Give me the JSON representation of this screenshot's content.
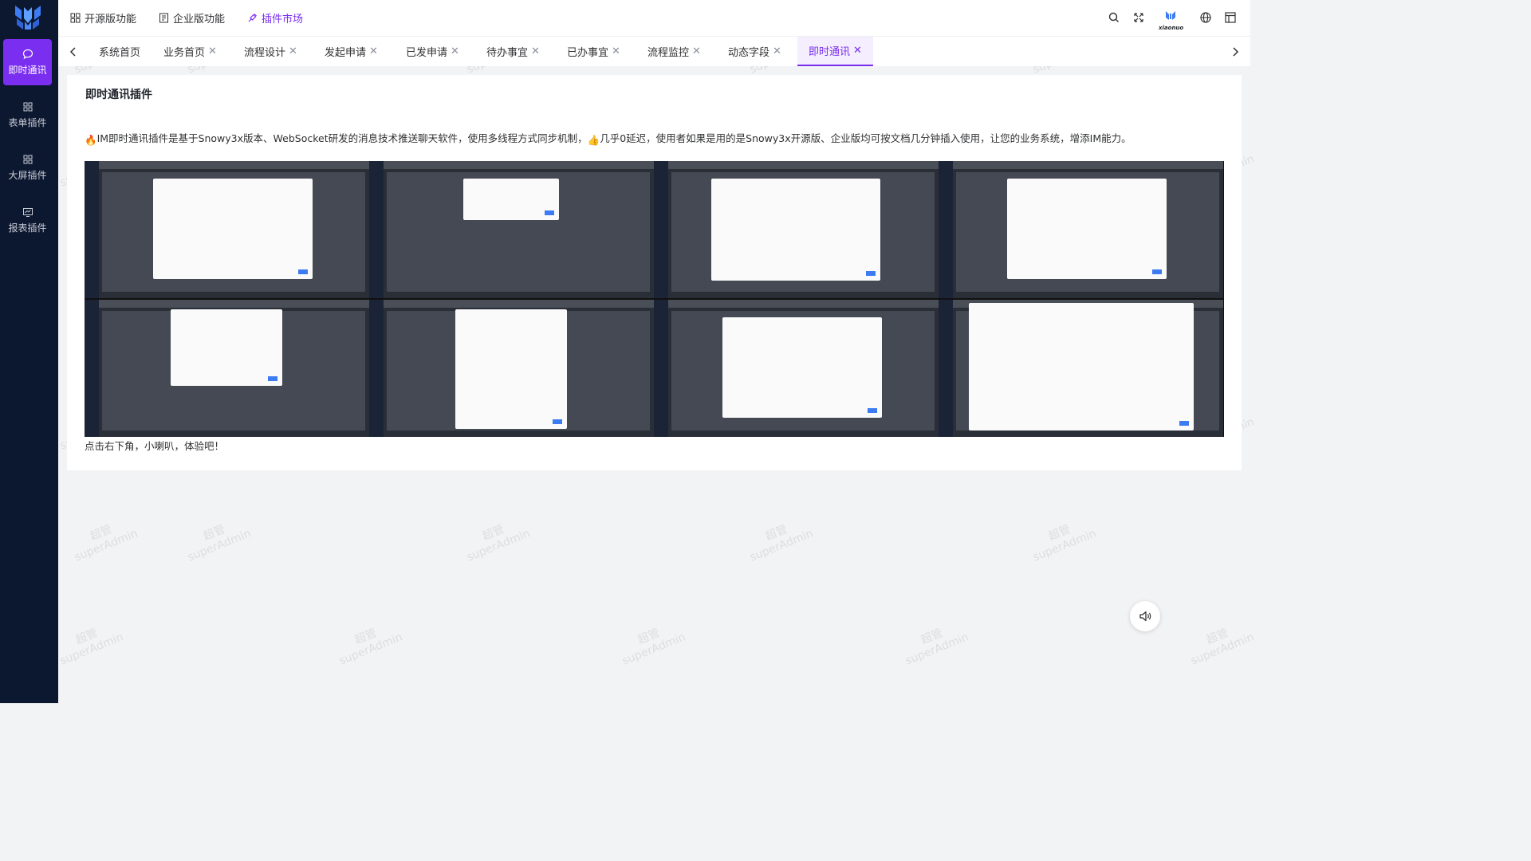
{
  "sidebar": {
    "items": [
      {
        "label": "即时通讯",
        "icon": "chat-icon",
        "active": true
      },
      {
        "label": "表单插件",
        "icon": "form-grid-icon",
        "active": false
      },
      {
        "label": "大屏插件",
        "icon": "dashboard-grid-icon",
        "active": false
      },
      {
        "label": "报表插件",
        "icon": "report-icon",
        "active": false
      }
    ]
  },
  "header": {
    "menus": [
      {
        "label": "开源版功能",
        "icon": "grid-icon"
      },
      {
        "label": "企业版功能",
        "icon": "document-icon"
      },
      {
        "label": "插件市场",
        "icon": "plugin-icon",
        "active": true
      }
    ],
    "brand_text": "xiaonuo"
  },
  "tabs": [
    {
      "label": "系统首页",
      "closable": false
    },
    {
      "label": "业务首页",
      "closable": true
    },
    {
      "label": "流程设计",
      "closable": true
    },
    {
      "label": "发起申请",
      "closable": true
    },
    {
      "label": "已发申请",
      "closable": true
    },
    {
      "label": "待办事宜",
      "closable": true
    },
    {
      "label": "已办事宜",
      "closable": true
    },
    {
      "label": "流程监控",
      "closable": true
    },
    {
      "label": "动态字段",
      "closable": true
    },
    {
      "label": "即时通讯",
      "closable": true,
      "active": true
    }
  ],
  "content": {
    "title": "即时通讯插件",
    "description_emoji_1": "🔥",
    "description_part1": "IM即时通讯插件是基于Snowy3x版本、WebSocket研发的消息技术推送聊天软件，使用多线程方式同步机制，",
    "description_emoji_2": "👍",
    "description_part2": "几乎0延迟，使用者如果是用的是Snowy3x开源版、企业版均可按文档几分钟插入使用，让您的业务系统，增添IM能力。",
    "footer_note": "点击右下角，小喇叭，体验吧！"
  },
  "watermark": {
    "cn": "超管",
    "en": "superAdmin"
  },
  "colors": {
    "primary": "#7a2ef0",
    "sidebar_bg": "#0c1730",
    "page_bg": "#f2f3f5"
  }
}
